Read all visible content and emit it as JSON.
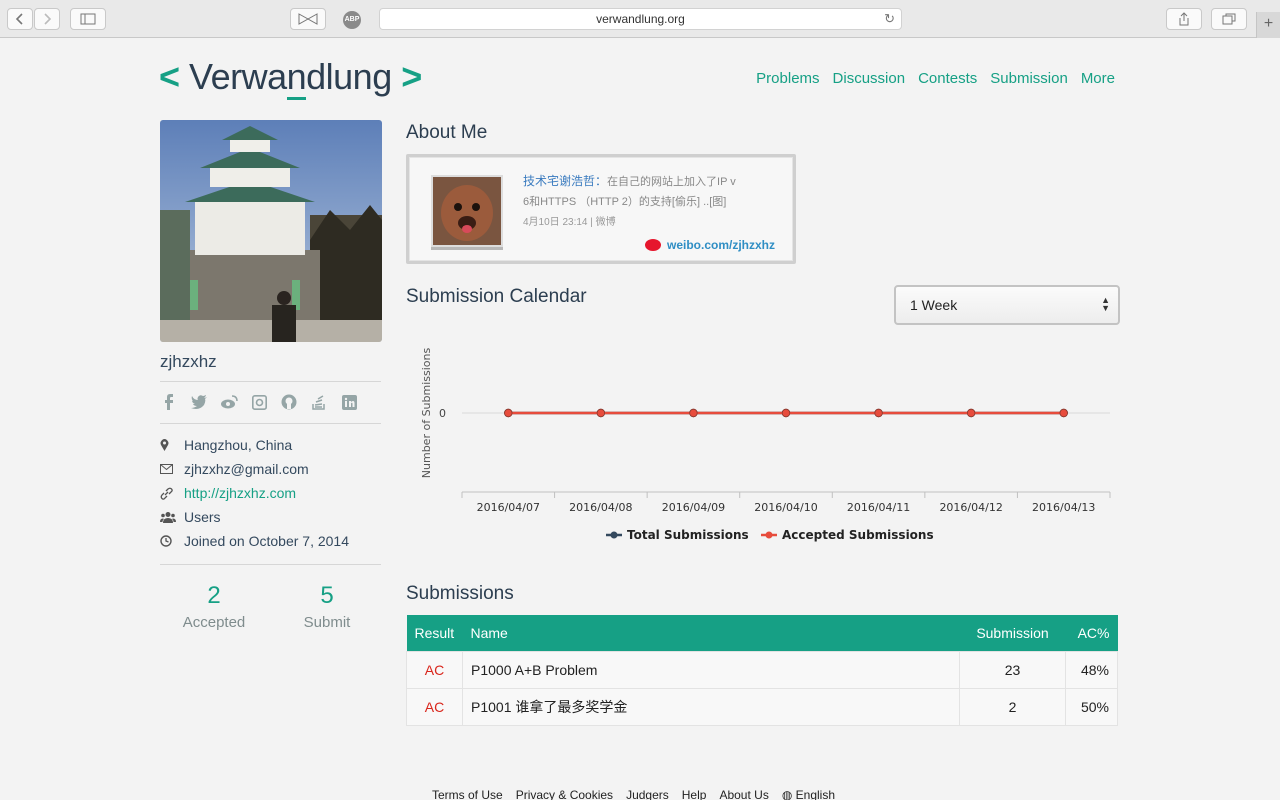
{
  "browser": {
    "url": "verwandlung.org",
    "abp_label": "ABP"
  },
  "header": {
    "logo_left": "<",
    "logo_text_a": "Verwa",
    "logo_text_b": "n",
    "logo_text_c": "dlung",
    "logo_right": ">",
    "nav": [
      "Problems",
      "Discussion",
      "Contests",
      "Submission",
      "More"
    ]
  },
  "profile": {
    "username": "zjhzxhz",
    "location": "Hangzhou, China",
    "email": "zjhzxhz@gmail.com",
    "website": "http://zjhzxhz.com",
    "group": "Users",
    "joined": "Joined on October 7, 2014",
    "accepted_count": "2",
    "accepted_label": "Accepted",
    "submit_count": "5",
    "submit_label": "Submit"
  },
  "about": {
    "title": "About Me",
    "weibo_user": "技术宅谢浩哲",
    "weibo_sep": "：",
    "weibo_text_1": "在自己的网站上加入了IP v",
    "weibo_text_2": "6和HTTPS （HTTP 2）的支持[偷乐] ..[图]",
    "weibo_time": "4月10日 23:14 | 微博",
    "weibo_link": "weibo.com/zjhzxhz"
  },
  "calendar": {
    "title": "Submission Calendar",
    "period_selected": "1 Week"
  },
  "chart_data": {
    "type": "line",
    "x": [
      "2016/04/07",
      "2016/04/08",
      "2016/04/09",
      "2016/04/10",
      "2016/04/11",
      "2016/04/12",
      "2016/04/13"
    ],
    "series": [
      {
        "name": "Total Submissions",
        "values": [
          0,
          0,
          0,
          0,
          0,
          0,
          0
        ],
        "color": "#34495e"
      },
      {
        "name": "Accepted Submissions",
        "values": [
          0,
          0,
          0,
          0,
          0,
          0,
          0
        ],
        "color": "#e74c3c"
      }
    ],
    "ylabel": "Number of Submissions",
    "yticks": [
      "0"
    ],
    "legend": "bottom"
  },
  "submissions": {
    "title": "Submissions",
    "columns": [
      "Result",
      "Name",
      "Submission",
      "AC%"
    ],
    "rows": [
      {
        "result": "AC",
        "name": "P1000 A+B Problem",
        "submission": "23",
        "ac": "48%"
      },
      {
        "result": "AC",
        "name": "P1001 谁拿了最多奖学金",
        "submission": "2",
        "ac": "50%"
      }
    ]
  },
  "footer": {
    "links": [
      "Terms of Use",
      "Privacy & Cookies",
      "Judgers",
      "Help",
      "About Us",
      "English"
    ]
  },
  "colors": {
    "accent": "#16a085",
    "ac_red": "#d9261c",
    "text_dark": "#2c3e50"
  }
}
